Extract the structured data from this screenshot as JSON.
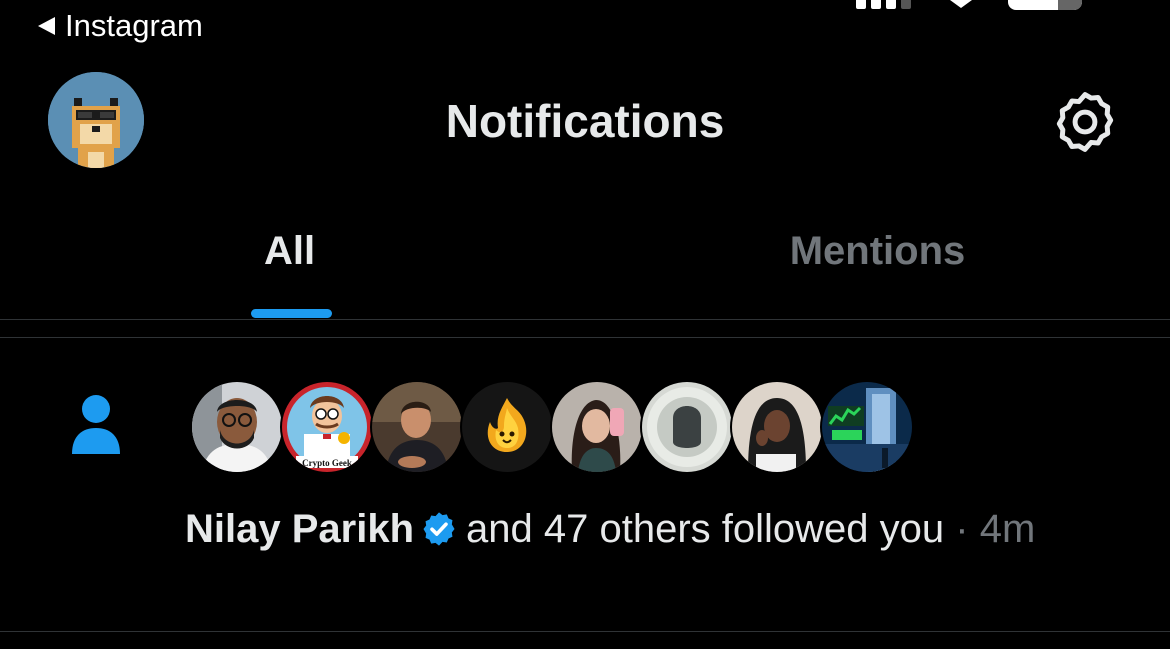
{
  "status_bar": {
    "back_label": "Instagram"
  },
  "header": {
    "title": "Notifications"
  },
  "tabs": [
    {
      "label": "All",
      "selected": true
    },
    {
      "label": "Mentions",
      "selected": false
    }
  ],
  "notification": {
    "icon": "person-icon",
    "name": "Nilay Parikh",
    "verified": true,
    "text": "and 47 others followed you",
    "separator": "·",
    "time": "4m",
    "avatar_badge_text": "Crypto Geek"
  },
  "colors": {
    "accent": "#1d9bf0",
    "background": "#000000",
    "text_primary": "#e7e9ea",
    "text_secondary": "#71767b",
    "divider": "#2f3336"
  }
}
